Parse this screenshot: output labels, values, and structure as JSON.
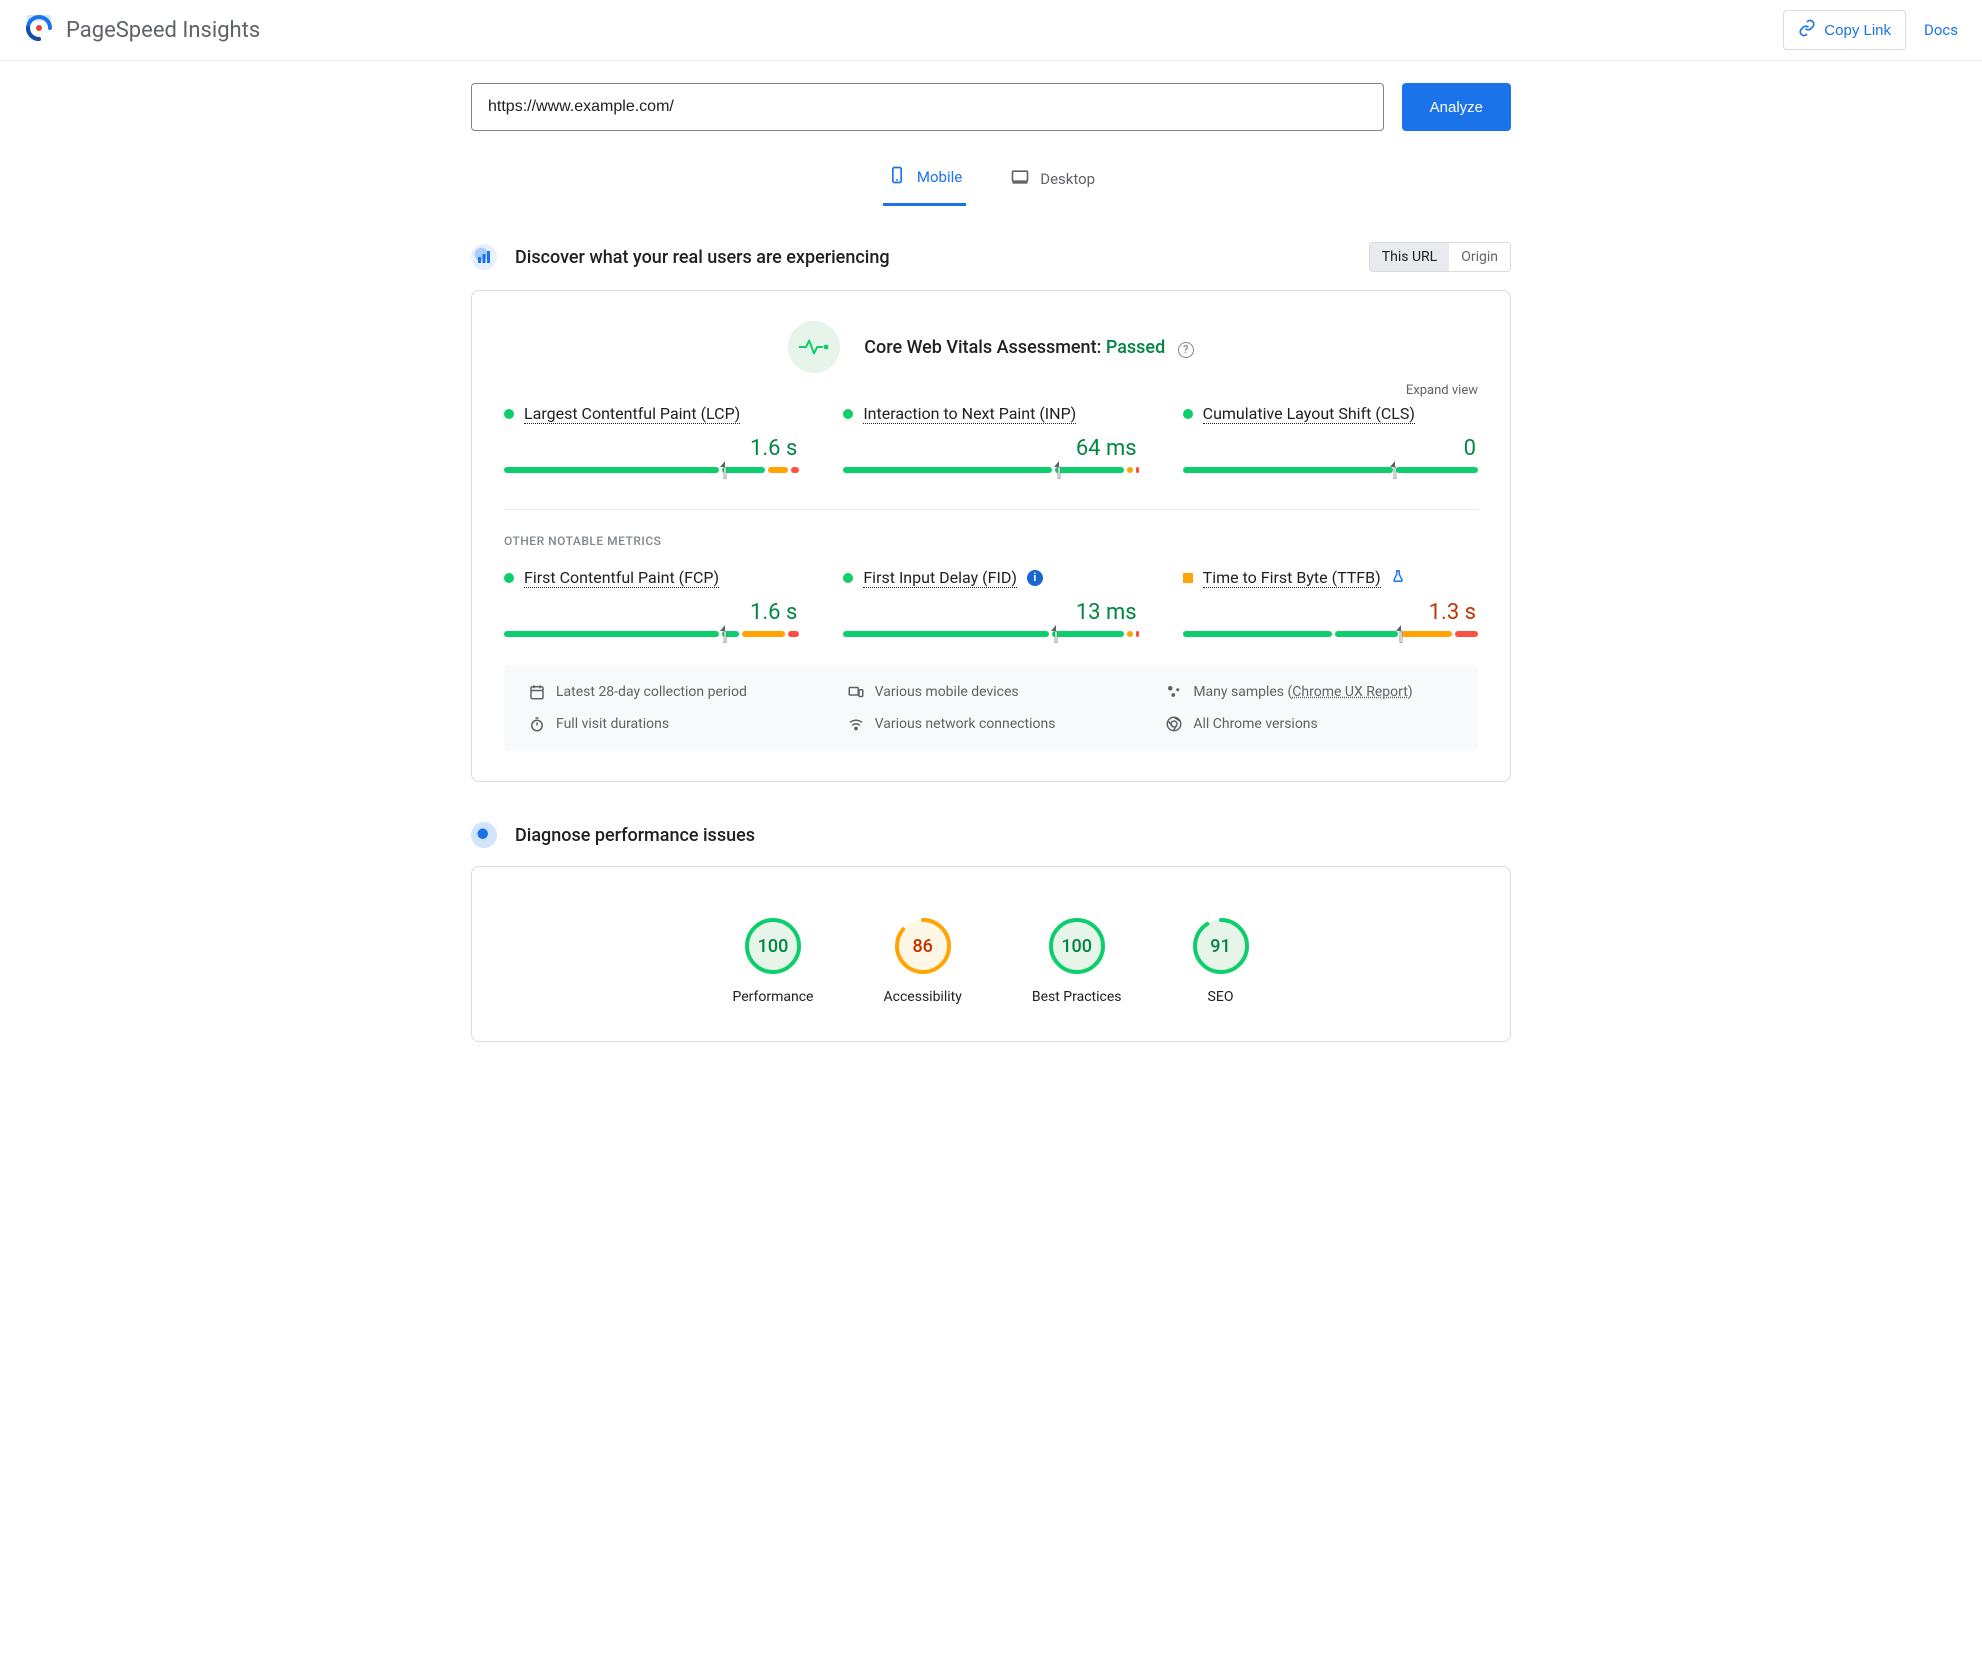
{
  "header": {
    "title": "PageSpeed Insights",
    "copy_link": "Copy Link",
    "docs": "Docs"
  },
  "url_input": {
    "value": "https://www.example.com/",
    "analyze": "Analyze"
  },
  "tabs": {
    "mobile": "Mobile",
    "desktop": "Desktop",
    "active": "mobile"
  },
  "field_data": {
    "section_title": "Discover what your real users are experiencing",
    "toggle": {
      "this_url": "This URL",
      "origin": "Origin",
      "active": "this_url"
    },
    "cwv_label": "Core Web Vitals Assessment:",
    "cwv_status": "Passed",
    "expand": "Expand view",
    "other_title": "OTHER NOTABLE METRICS",
    "metrics": [
      {
        "id": "lcp",
        "name": "Largest Contentful Paint (LCP)",
        "value": "1.6 s",
        "status": "good",
        "segments": [
          75,
          15,
          7,
          3
        ],
        "marker": 75
      },
      {
        "id": "inp",
        "name": "Interaction to Next Paint (INP)",
        "value": "64 ms",
        "status": "good",
        "segments": [
          73,
          24,
          2,
          1
        ],
        "marker": 73
      },
      {
        "id": "cls",
        "name": "Cumulative Layout Shift (CLS)",
        "value": "0",
        "status": "good",
        "segments": [
          72,
          28,
          0,
          0
        ],
        "marker": 72
      }
    ],
    "other_metrics": [
      {
        "id": "fcp",
        "name": "First Contentful Paint (FCP)",
        "value": "1.6 s",
        "status": "good",
        "segments": [
          75,
          6,
          15,
          4
        ],
        "marker": 75,
        "info": false
      },
      {
        "id": "fid",
        "name": "First Input Delay (FID)",
        "value": "13 ms",
        "status": "good",
        "segments": [
          72,
          25,
          2,
          1
        ],
        "marker": 72,
        "info": true
      },
      {
        "id": "ttfb",
        "name": "Time to First Byte (TTFB)",
        "value": "1.3 s",
        "status": "avg",
        "segments": [
          52,
          22,
          18,
          8
        ],
        "marker": 74,
        "flask": true
      }
    ],
    "info_box": {
      "period": "Latest 28-day collection period",
      "devices": "Various mobile devices",
      "samples_pre": "Many samples (",
      "samples_link": "Chrome UX Report",
      "samples_post": ")",
      "visit": "Full visit durations",
      "network": "Various network connections",
      "browsers": "All Chrome versions"
    }
  },
  "lab": {
    "section_title": "Diagnose performance issues",
    "scores": [
      {
        "id": "performance",
        "label": "Performance",
        "value": 100,
        "color": "good"
      },
      {
        "id": "accessibility",
        "label": "Accessibility",
        "value": 86,
        "color": "avg"
      },
      {
        "id": "best-practices",
        "label": "Best Practices",
        "value": 100,
        "color": "good"
      },
      {
        "id": "seo",
        "label": "SEO",
        "value": 91,
        "color": "good"
      }
    ]
  },
  "chart_data": {
    "type": "bar",
    "note": "Stacked distribution bars per metric plus category gauges",
    "stacked_distribution_metrics": [
      {
        "metric": "LCP",
        "value": "1.6 s",
        "status": "good",
        "good_pct": 75,
        "good2_pct": 15,
        "needs_improvement_pct": 7,
        "poor_pct": 3
      },
      {
        "metric": "INP",
        "value": "64 ms",
        "status": "good",
        "good_pct": 73,
        "good2_pct": 24,
        "needs_improvement_pct": 2,
        "poor_pct": 1
      },
      {
        "metric": "CLS",
        "value": "0",
        "status": "good",
        "good_pct": 72,
        "good2_pct": 28,
        "needs_improvement_pct": 0,
        "poor_pct": 0
      },
      {
        "metric": "FCP",
        "value": "1.6 s",
        "status": "good",
        "good_pct": 75,
        "good2_pct": 6,
        "needs_improvement_pct": 15,
        "poor_pct": 4
      },
      {
        "metric": "FID",
        "value": "13 ms",
        "status": "good",
        "good_pct": 72,
        "good2_pct": 25,
        "needs_improvement_pct": 2,
        "poor_pct": 1
      },
      {
        "metric": "TTFB",
        "value": "1.3 s",
        "status": "needs_improvement",
        "good_pct": 52,
        "good2_pct": 22,
        "needs_improvement_pct": 18,
        "poor_pct": 8
      }
    ],
    "category_gauges": {
      "categories": [
        "Performance",
        "Accessibility",
        "Best Practices",
        "SEO"
      ],
      "values": [
        100,
        86,
        100,
        91
      ],
      "ylim": [
        0,
        100
      ]
    }
  }
}
